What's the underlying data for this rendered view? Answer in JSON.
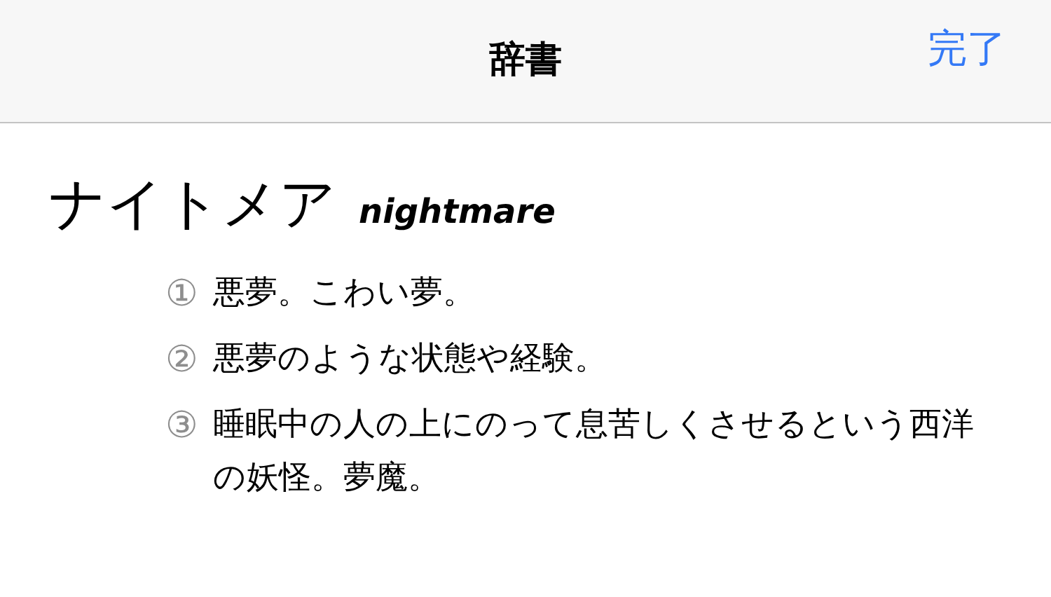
{
  "nav_bar": {
    "title": "辞書",
    "done_button": "完了"
  },
  "entry": {
    "headword": "ナイトメア",
    "english": "nightmare"
  },
  "senses": [
    {
      "number": "①",
      "text": "悪夢。こわい夢。"
    },
    {
      "number": "②",
      "text": "悪夢のような状態や経験。"
    },
    {
      "number": "③",
      "text": "睡眠中の人の上にのって息苦しくさせるという西洋の妖怪。夢魔。"
    }
  ]
}
